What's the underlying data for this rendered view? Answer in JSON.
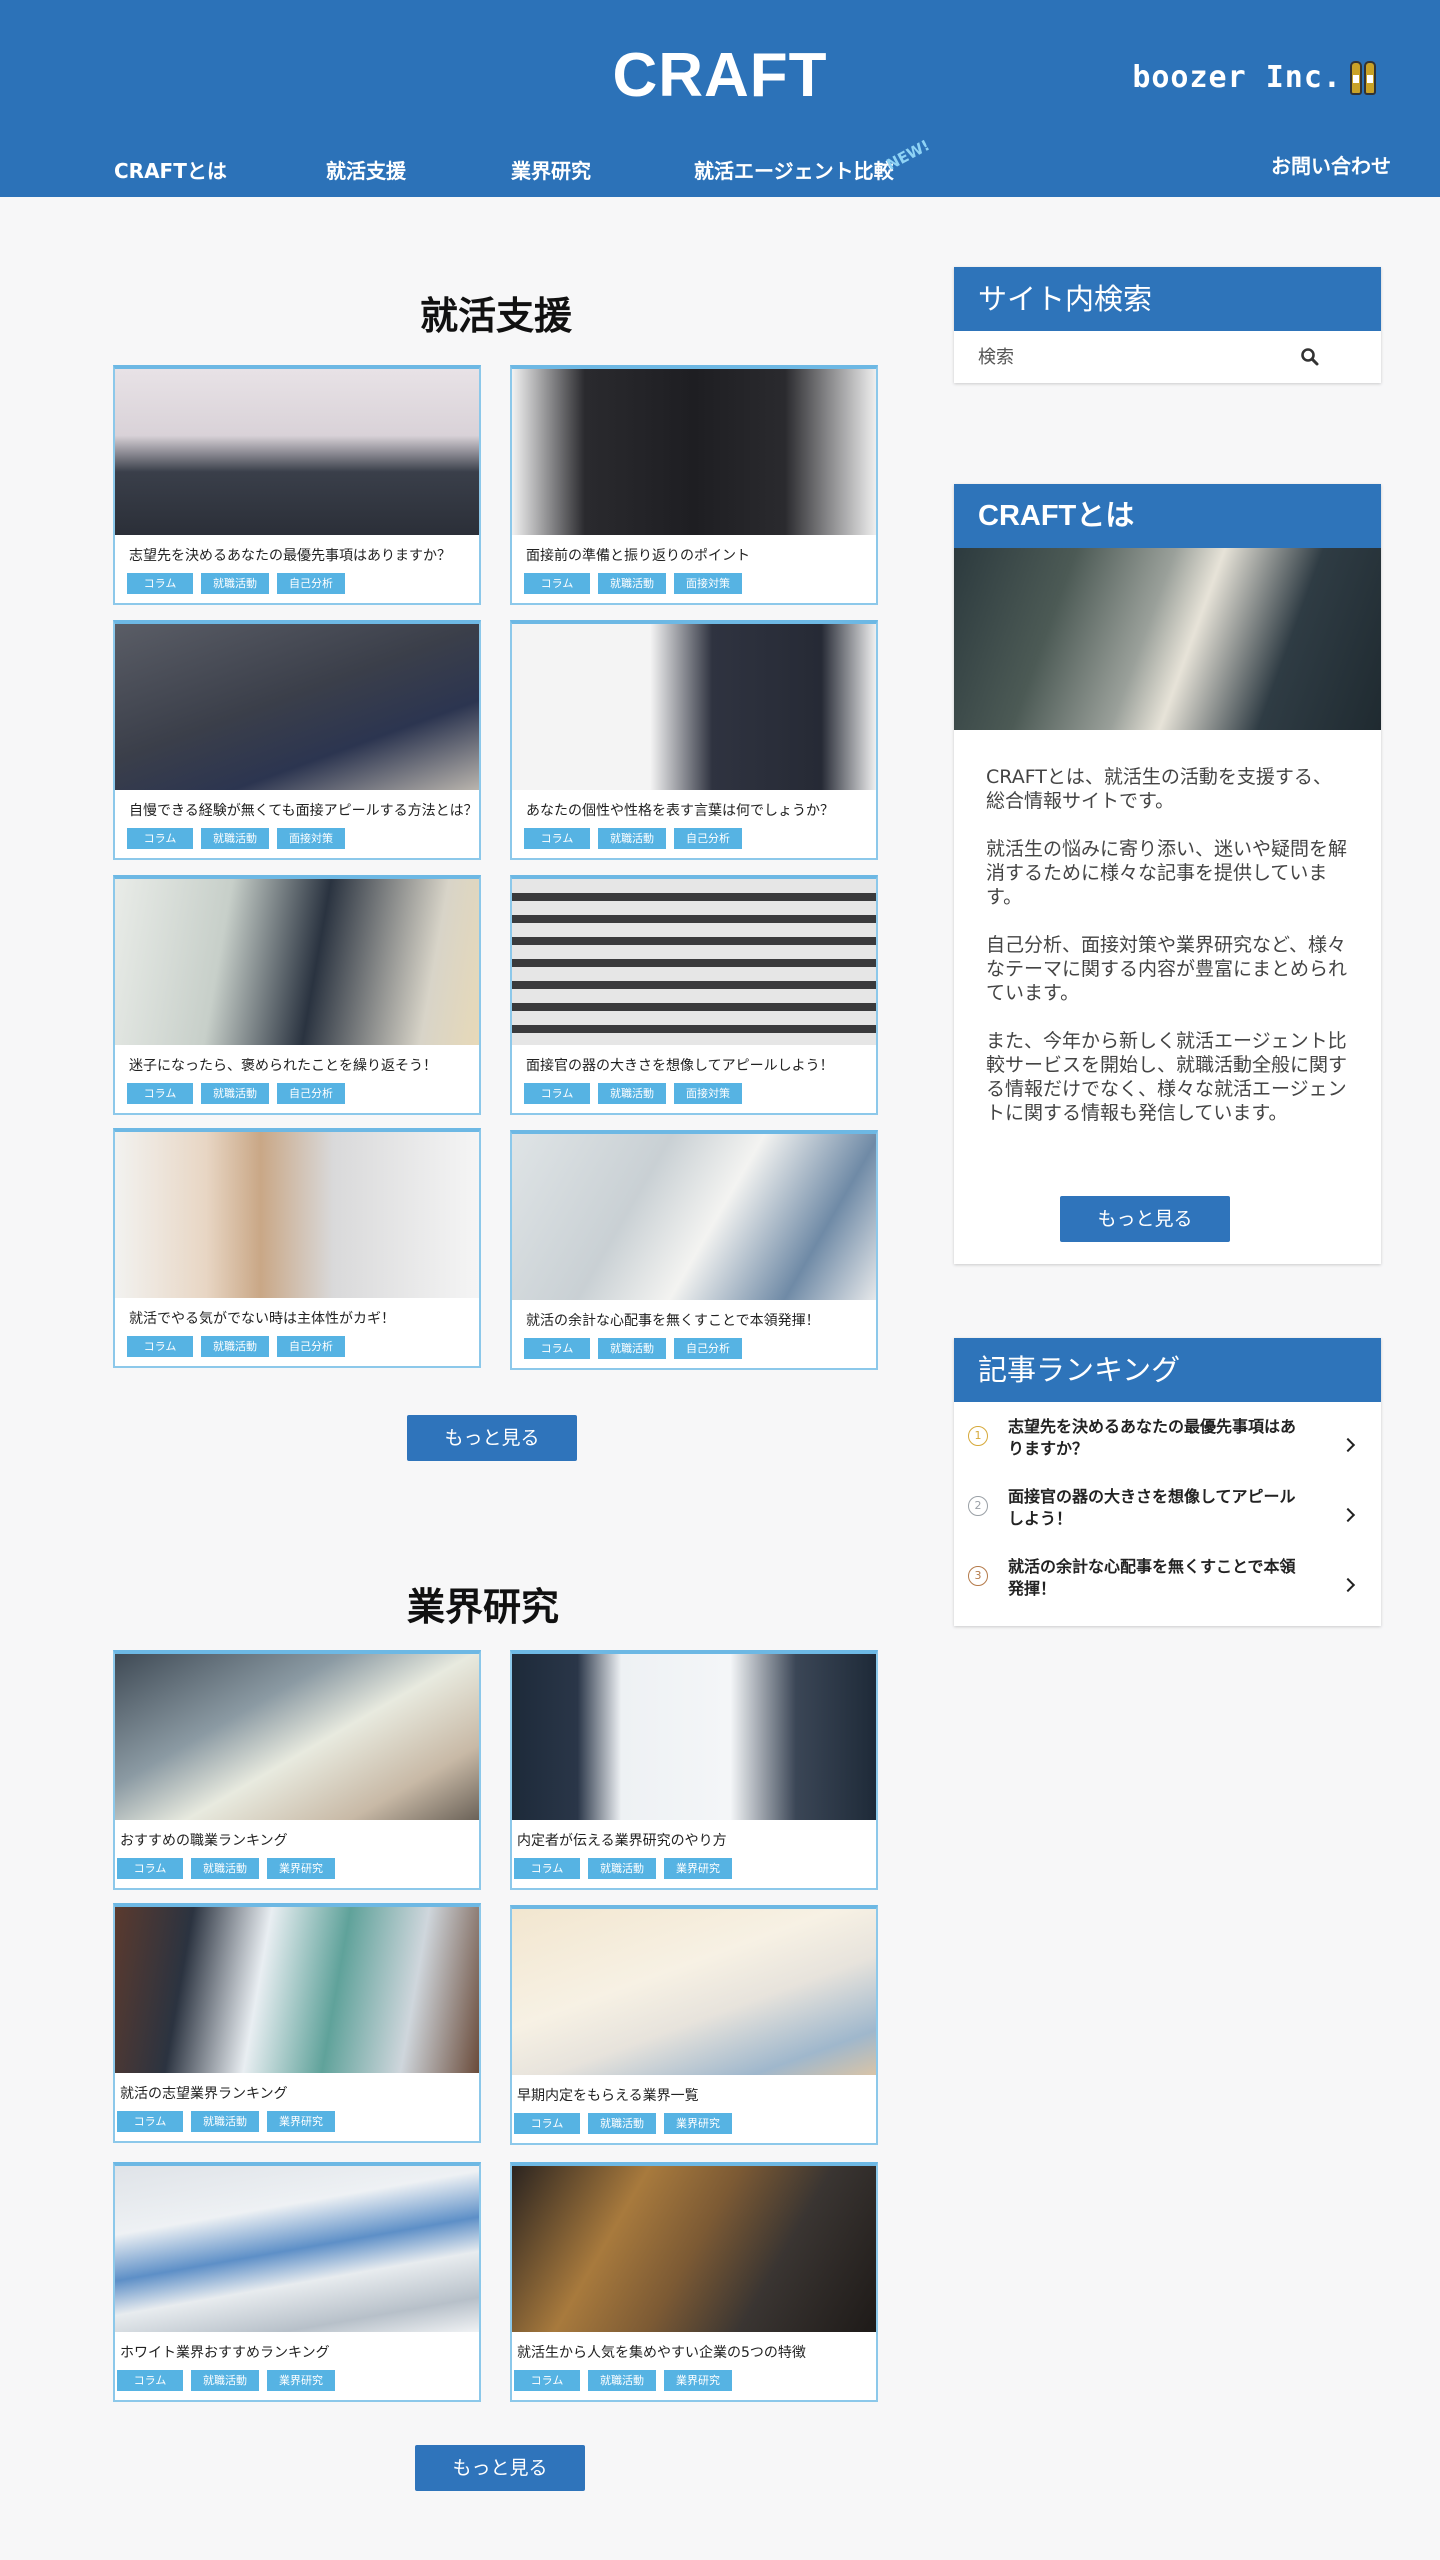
{
  "header": {
    "logo": "CRAFT",
    "brand": "boozer Inc.",
    "nav": [
      "CRAFTとは",
      "就活支援",
      "業界研究",
      "就活エージェント比較",
      "お問い合わせ"
    ],
    "new_badge": "NEW!"
  },
  "support": {
    "title": "就活支援",
    "cards": [
      {
        "title": "志望先を決めるあなたの最優先事項はありますか？",
        "tags": [
          "コラム",
          "就職活動",
          "自己分析"
        ]
      },
      {
        "title": "面接前の準備と振り返りのポイント",
        "tags": [
          "コラム",
          "就職活動",
          "面接対策"
        ]
      },
      {
        "title": "自慢できる経験が無くても面接アピールする方法とは？",
        "tags": [
          "コラム",
          "就職活動",
          "面接対策"
        ]
      },
      {
        "title": "あなたの個性や性格を表す言葉は何でしょうか？",
        "tags": [
          "コラム",
          "就職活動",
          "自己分析"
        ]
      },
      {
        "title": "迷子になったら、褒められたことを繰り返そう！",
        "tags": [
          "コラム",
          "就職活動",
          "自己分析"
        ]
      },
      {
        "title": "面接官の器の大きさを想像してアピールしよう！",
        "tags": [
          "コラム",
          "就職活動",
          "面接対策"
        ]
      },
      {
        "title": "就活でやる気がでない時は主体性がカギ！",
        "tags": [
          "コラム",
          "就職活動",
          "自己分析"
        ]
      },
      {
        "title": "就活の余計な心配事を無くすことで本領発揮！",
        "tags": [
          "コラム",
          "就職活動",
          "自己分析"
        ]
      }
    ],
    "more_label": "もっと見る"
  },
  "industry": {
    "title": "業界研究",
    "cards": [
      {
        "title": "おすすめの職業ランキング",
        "tags": [
          "コラム",
          "就職活動",
          "業界研究"
        ]
      },
      {
        "title": "内定者が伝える業界研究のやり方",
        "tags": [
          "コラム",
          "就職活動",
          "業界研究"
        ]
      },
      {
        "title": "就活の志望業界ランキング",
        "tags": [
          "コラム",
          "就職活動",
          "業界研究"
        ]
      },
      {
        "title": "早期内定をもらえる業界一覧",
        "tags": [
          "コラム",
          "就職活動",
          "業界研究"
        ]
      },
      {
        "title": "ホワイト業界おすすめランキング",
        "tags": [
          "コラム",
          "就職活動",
          "業界研究"
        ]
      },
      {
        "title": "就活生から人気を集めやすい企業の5つの特徴",
        "tags": [
          "コラム",
          "就職活動",
          "業界研究"
        ]
      }
    ],
    "more_label": "もっと見る"
  },
  "sidebar": {
    "search": {
      "title": "サイト内検索",
      "placeholder": "検索"
    },
    "about": {
      "title": "CRAFTとは",
      "paragraphs": [
        "CRAFTとは、就活生の活動を支援する、総合情報サイトです。",
        "就活生の悩みに寄り添い、迷いや疑問を解消するために様々な記事を提供しています。",
        "自己分析、面接対策や業界研究など、様々なテーマに関する内容が豊富にまとめられています。",
        "また、今年から新しく就活エージェント比較サービスを開始し、就職活動全般に関する情報だけでなく、様々な就活エージェントに関する情報も発信しています。"
      ],
      "more_label": "もっと見る"
    },
    "ranking": {
      "title": "記事ランキング",
      "items": [
        {
          "num": "1",
          "title": "志望先を決めるあなたの最優先事項はありますか？"
        },
        {
          "num": "2",
          "title": "面接官の器の大きさを想像してアピールしよう！"
        },
        {
          "num": "3",
          "title": "就活の余計な心配事を無くすことで本領発揮！"
        }
      ]
    }
  },
  "colors": {
    "header": "#2c72b8",
    "tag": "#56b3e3",
    "button": "#2f74bb",
    "rank_gold": "#d6a93a",
    "rank_silver": "#9aa0a6",
    "rank_bronze": "#b47a4a"
  }
}
